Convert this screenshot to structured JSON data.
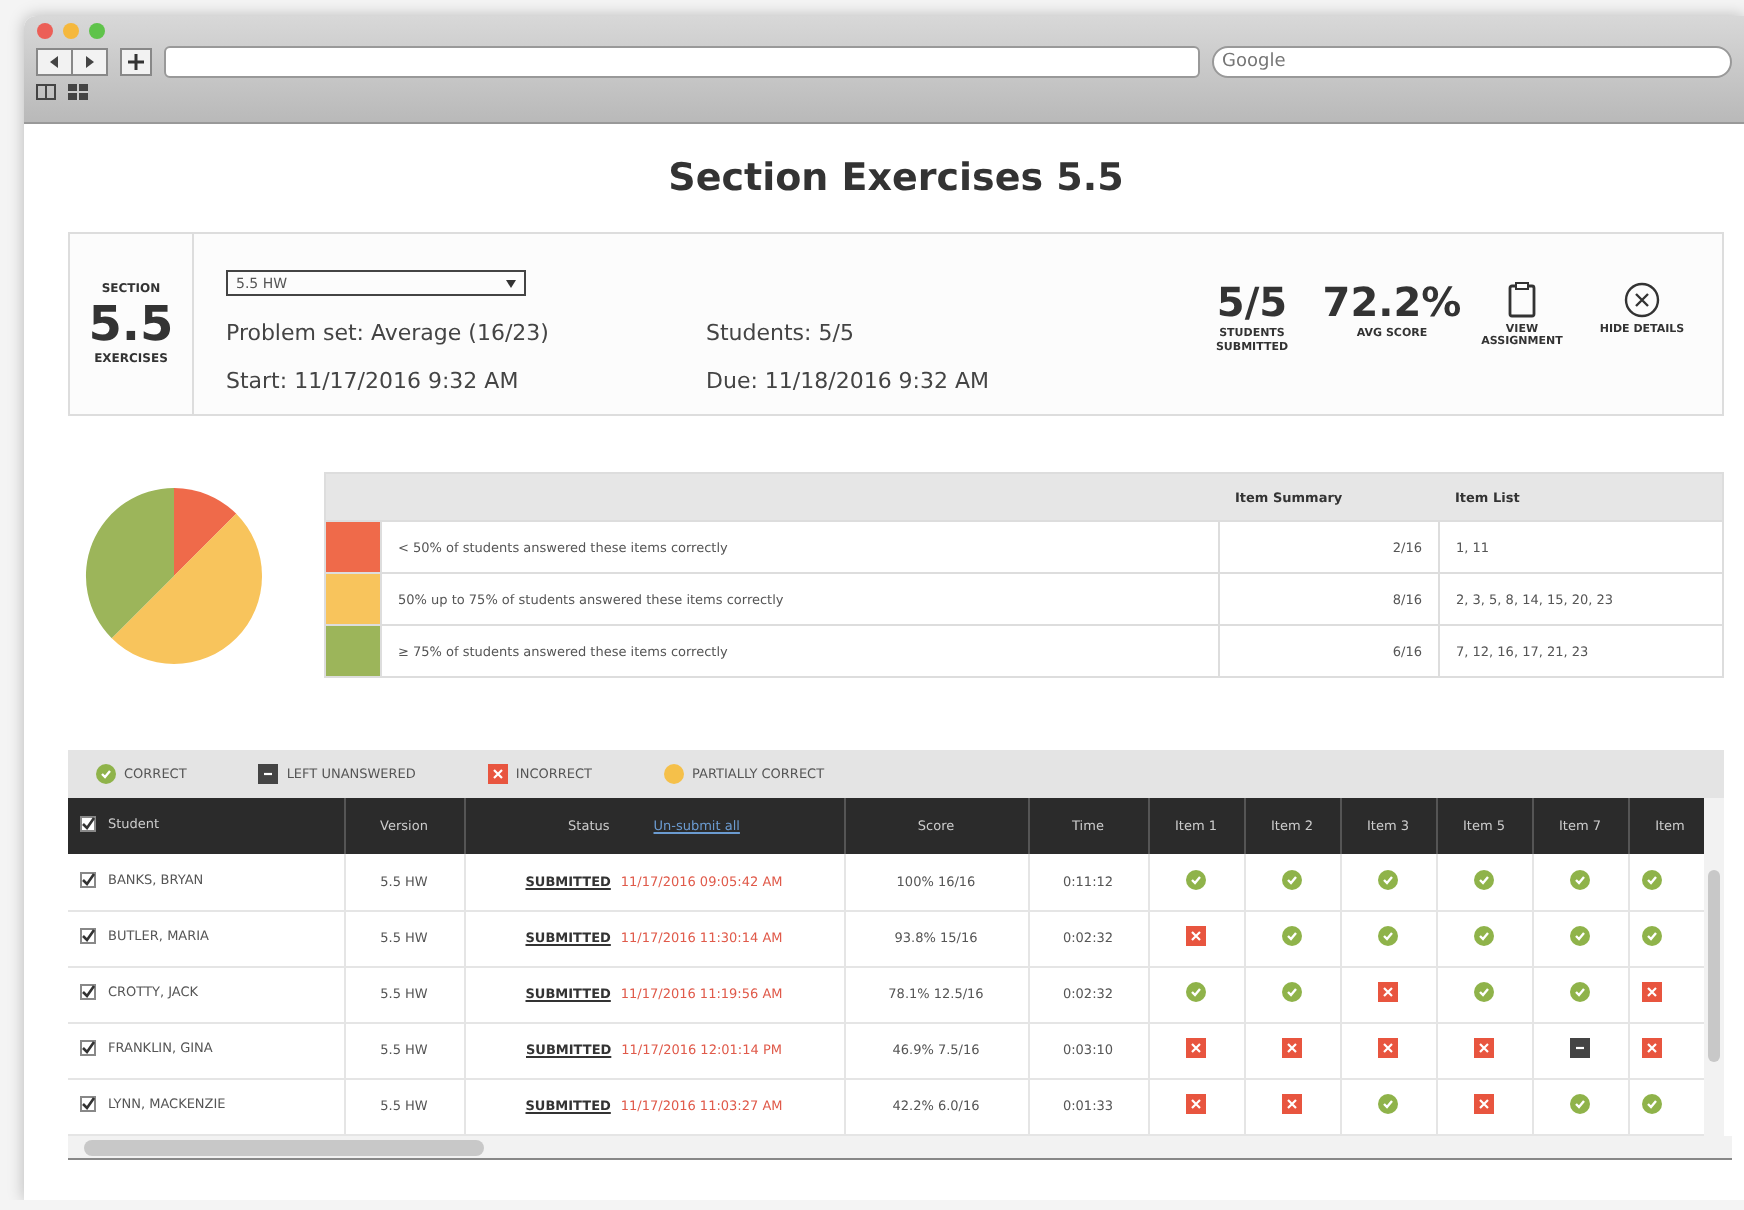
{
  "browser": {
    "search_placeholder": "Google"
  },
  "title": "Section Exercises 5.5",
  "section": {
    "top": "SECTION",
    "number": "5.5",
    "bottom": "EXERCISES"
  },
  "assignment": {
    "version": "5.5 HW",
    "problem_set": "Problem set: Average (16/23)",
    "start": "Start: 11/17/2016 9:32 AM",
    "students": "Students: 5/5",
    "due": "Due: 11/18/2016 9:32 AM"
  },
  "stats": [
    {
      "value": "5/5",
      "label": "STUDENTS SUBMITTED"
    },
    {
      "value": "72.2%",
      "label": "AVG SCORE"
    }
  ],
  "actions": [
    {
      "kind": "view",
      "label": "VIEW ASSIGNMENT"
    },
    {
      "kind": "hide",
      "label": "HIDE DETAILS"
    }
  ],
  "summary": {
    "columns": [
      "Item Summary",
      "Item List"
    ],
    "rows": [
      {
        "color": "#ef6a4a",
        "text": "< 50% of students answered these items correctly",
        "summary": "2/16",
        "items": "1, 11"
      },
      {
        "color": "#f8c45c",
        "text": "50% up to 75% of students answered these items correctly",
        "summary": "8/16",
        "items": "2, 3, 5, 8, 14, 15, 20, 23"
      },
      {
        "color": "#9cb55a",
        "text": "≥ 75% of students answered these items correctly",
        "summary": "6/16",
        "items": "7, 12, 16, 17, 21, 23"
      }
    ],
    "chart_data": {
      "type": "pie",
      "values": [
        12.5,
        50,
        37.5
      ]
    }
  },
  "legend": [
    {
      "kind": "correct",
      "label": "CORRECT"
    },
    {
      "kind": "unanswered",
      "label": "LEFT UNANSWERED"
    },
    {
      "kind": "incorrect",
      "label": "INCORRECT"
    },
    {
      "kind": "partial",
      "label": "PARTIALLY CORRECT"
    }
  ],
  "table": {
    "select_all": {
      "checked": true
    },
    "columns": [
      "Student",
      "Version",
      "Status",
      "Score",
      "Time",
      "Item 1",
      "Item 2",
      "Item 3",
      "Item 5",
      "Item 7",
      "Item"
    ],
    "unsubmit_link": "Un-submit all",
    "rows": [
      {
        "checked": true,
        "student": "BANKS, BRYAN",
        "version": "5.5 HW",
        "status": "SUBMITTED",
        "date": "11/17/2016 09:05:42 AM",
        "score": "100%  16/16",
        "time": "0:11:12",
        "items": [
          {
            "kind": "correct"
          },
          {
            "kind": "correct"
          },
          {
            "kind": "correct"
          },
          {
            "kind": "correct"
          },
          {
            "kind": "correct"
          },
          {
            "kind": "correct"
          }
        ]
      },
      {
        "checked": true,
        "student": "BUTLER, MARIA",
        "version": "5.5 HW",
        "status": "SUBMITTED",
        "date": "11/17/2016 11:30:14 AM",
        "score": "93.8%  15/16",
        "time": "0:02:32",
        "items": [
          {
            "kind": "incorrect"
          },
          {
            "kind": "correct"
          },
          {
            "kind": "correct"
          },
          {
            "kind": "correct"
          },
          {
            "kind": "correct"
          },
          {
            "kind": "correct"
          }
        ]
      },
      {
        "checked": true,
        "student": "CROTTY, JACK",
        "version": "5.5 HW",
        "status": "SUBMITTED",
        "date": "11/17/2016 11:19:56 AM",
        "score": "78.1%  12.5/16",
        "time": "0:02:32",
        "items": [
          {
            "kind": "correct"
          },
          {
            "kind": "correct"
          },
          {
            "kind": "incorrect"
          },
          {
            "kind": "correct"
          },
          {
            "kind": "correct"
          },
          {
            "kind": "incorrect"
          }
        ]
      },
      {
        "checked": true,
        "student": "FRANKLIN, GINA",
        "version": "5.5 HW",
        "status": "SUBMITTED",
        "date": "11/17/2016 12:01:14 PM",
        "score": "46.9%  7.5/16",
        "time": "0:03:10",
        "items": [
          {
            "kind": "incorrect"
          },
          {
            "kind": "incorrect"
          },
          {
            "kind": "incorrect"
          },
          {
            "kind": "incorrect"
          },
          {
            "kind": "unanswered"
          },
          {
            "kind": "incorrect"
          }
        ]
      },
      {
        "checked": true,
        "student": "LYNN, MACKENZIE",
        "version": "5.5 HW",
        "status": "SUBMITTED",
        "date": "11/17/2016 11:03:27 AM",
        "score": "42.2%  6.0/16",
        "time": "0:01:33",
        "items": [
          {
            "kind": "incorrect"
          },
          {
            "kind": "incorrect"
          },
          {
            "kind": "correct"
          },
          {
            "kind": "incorrect"
          },
          {
            "kind": "correct"
          },
          {
            "kind": "correct"
          }
        ]
      }
    ]
  }
}
